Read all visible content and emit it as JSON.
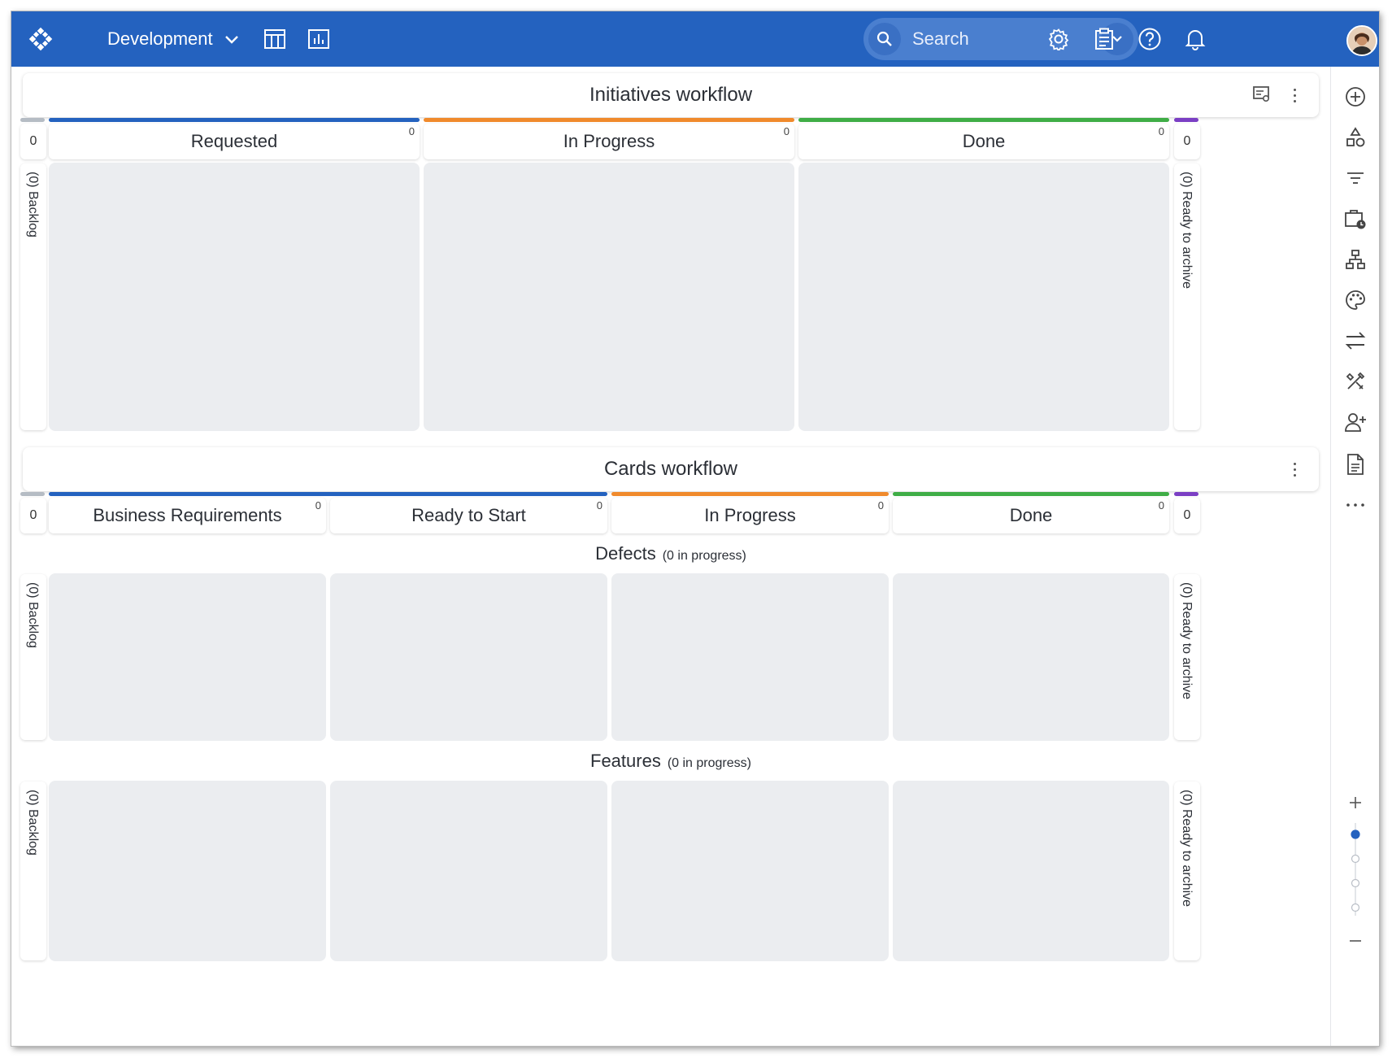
{
  "topbar": {
    "board_name": "Development",
    "search_placeholder": "Search",
    "colors": {
      "bar": "#2462bf"
    }
  },
  "initiatives": {
    "title": "Initiatives workflow",
    "left_count": "0",
    "right_count": "0",
    "backlog_label": "(0) Backlog",
    "archive_label": "(0) Ready to archive",
    "columns": [
      {
        "label": "Requested",
        "count": "0",
        "color": "#2462bf"
      },
      {
        "label": "In Progress",
        "count": "0",
        "color": "#f08a2c"
      },
      {
        "label": "Done",
        "count": "0",
        "color": "#3fad46"
      }
    ]
  },
  "cards": {
    "title": "Cards workflow",
    "left_count": "0",
    "right_count": "0",
    "columns": [
      {
        "label": "Business Requirements",
        "count": "0",
        "color": "#2462bf"
      },
      {
        "label": "Ready to Start",
        "count": "0",
        "color": "#2462bf"
      },
      {
        "label": "In Progress",
        "count": "0",
        "color": "#f08a2c"
      },
      {
        "label": "Done",
        "count": "0",
        "color": "#3fad46"
      }
    ],
    "lanes": [
      {
        "name": "Defects",
        "status": "(0 in progress)",
        "backlog_label": "(0) Backlog",
        "archive_label": "(0) Ready to archive"
      },
      {
        "name": "Features",
        "status": "(0 in progress)",
        "backlog_label": "(0) Backlog",
        "archive_label": "(0) Ready to archive"
      }
    ]
  },
  "side_colors": {
    "backlog": "#b5bcc4",
    "archive": "#7b3fc4"
  },
  "rail": {
    "icons": [
      "add-circle-icon",
      "shapes-icon",
      "filter-icon",
      "briefcase-clock-icon",
      "hierarchy-icon",
      "palette-icon",
      "swap-arrows-icon",
      "tools-icon",
      "add-user-icon",
      "document-icon",
      "more-icon"
    ],
    "zoom_level": 1,
    "zoom_steps": 4
  }
}
